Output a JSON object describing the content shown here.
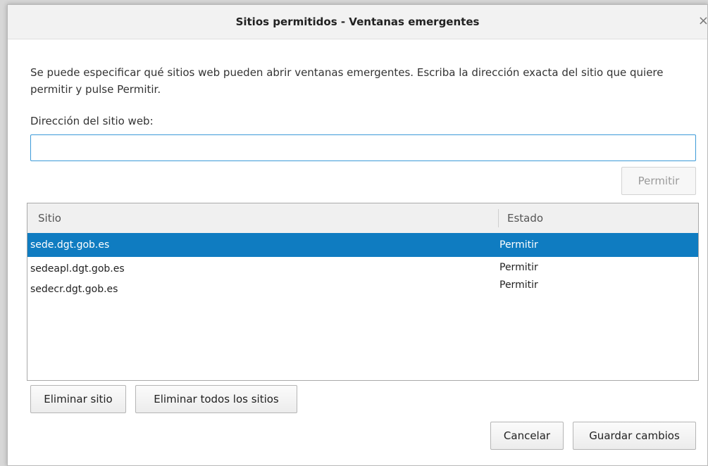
{
  "dialog": {
    "title": "Sitios permitidos - Ventanas emergentes",
    "close_glyph": "×",
    "description": "Se puede especificar qué sitios web pueden abrir ventanas emergentes. Escriba la dirección exacta del sitio que quiere permitir y pulse Permitir.",
    "address_label": "Dirección del sitio web:",
    "address_value": "",
    "permit_button": "Permitir"
  },
  "table": {
    "headers": [
      "Sitio",
      "Estado"
    ],
    "rows": [
      {
        "site": "sede.dgt.gob.es",
        "status": "Permitir",
        "selected": true
      },
      {
        "site": "sedeapl.dgt.gob.es",
        "status": "Permitir",
        "selected": false
      },
      {
        "site": "sedecr.dgt.gob.es",
        "status": "Permitir",
        "selected": false
      }
    ]
  },
  "buttons": {
    "remove_site": "Eliminar sitio",
    "remove_all": "Eliminar todos los sitios",
    "cancel": "Cancelar",
    "save": "Guardar cambios"
  },
  "colors": {
    "selection": "#0f7cc1",
    "input_focus_border": "#3c9ad8"
  },
  "icons": {
    "close": "close-icon"
  }
}
